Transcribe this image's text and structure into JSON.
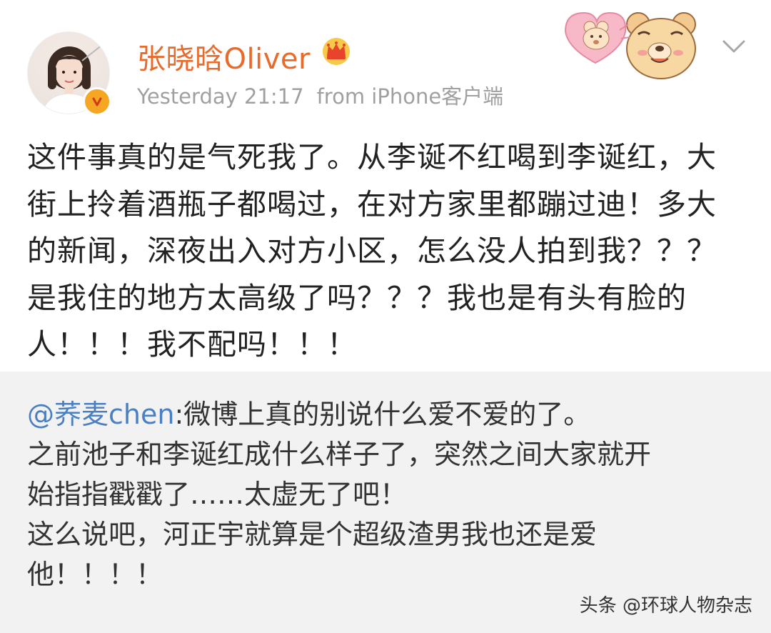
{
  "post": {
    "author": {
      "username": "张晓晗Oliver",
      "verified_icon": "verified-v-icon",
      "crown_icon": "crown-icon"
    },
    "meta": {
      "time": "Yesterday 21:17",
      "source": "from iPhone客户端"
    },
    "sticker_icon": "bear-sticker-icon",
    "menu_icon": "chevron-down-icon",
    "text": "这件事真的是气死我了。从李诞不红喝到李诞红，大街上拎着酒瓶子都喝过，在对方家里都蹦过迪！多大的新闻，深夜出入对方小区，怎么没人拍到我？？？是我住的地方太高级了吗？？？我也是有头有脸的人！！！我不配吗！！！"
  },
  "repost": {
    "mention": "@荞麦chen",
    "lines": [
      ":微博上真的别说什么爱不爱的了。",
      "之前池子和李诞红成什么样子了，突然之间大家就开",
      "始指指戳戳了……太虚无了吧！",
      "这么说吧，河正宇就算是个超级渣男我也还是爱",
      "他！！！！"
    ]
  },
  "watermark": "头条 @环球人物杂志",
  "colors": {
    "username": "#e86b2c",
    "mention": "#4a7fc1",
    "meta": "#a0a0a0",
    "repost_bg": "#f2f2f2",
    "badge": "#f5a623"
  }
}
